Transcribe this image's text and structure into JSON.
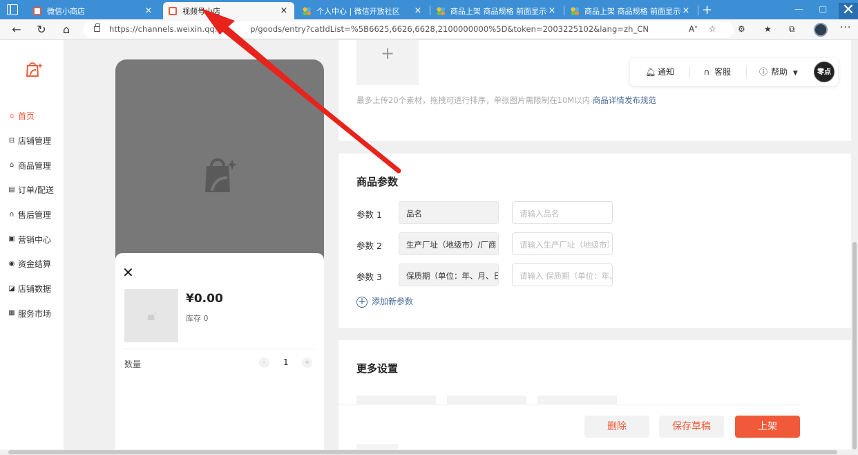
{
  "browser": {
    "tabs": [
      {
        "title": "微信小商店",
        "favicon": "red-bag-icon"
      },
      {
        "title": "视频号小店",
        "favicon": "red-bag-icon"
      },
      {
        "title": "个人中心 | 微信开放社区",
        "favicon": "colorful-dots-icon"
      },
      {
        "title": "商品上架 商品规格 前面显示很乱",
        "favicon": "colorful-dots-icon"
      },
      {
        "title": "商品上架 商品规格 前面显示很乱",
        "favicon": "colorful-dots-icon"
      }
    ],
    "active_tab": 1,
    "url": "https://channels.weixin.qq.com/shop/goods/entry?catIdList=%5B6625,6626,6628,2100000000%5D&token=2003225102&lang=zh_CN",
    "url_shown": "https://channels.weixin.qq.co",
    "url_shown_tail": "p/goods/entry?catIdList=%5B6625,6626,6628,2100000000%5D&token=2003225102&lang=zh_CN",
    "tab_close": "×",
    "new_tab": "+",
    "window_close": "✕"
  },
  "sidebar": {
    "items": [
      {
        "label": "首页",
        "icon": "home-icon",
        "active": true
      },
      {
        "label": "店铺管理",
        "icon": "store-icon"
      },
      {
        "label": "商品管理",
        "icon": "bag-icon"
      },
      {
        "label": "订单/配送",
        "icon": "order-icon"
      },
      {
        "label": "售后管理",
        "icon": "headset-icon"
      },
      {
        "label": "营销中心",
        "icon": "coupon-icon"
      },
      {
        "label": "资金结算",
        "icon": "yuan-icon"
      },
      {
        "label": "店铺数据",
        "icon": "chart-icon"
      },
      {
        "label": "服务市场",
        "icon": "grid-icon"
      }
    ]
  },
  "preview": {
    "price": "¥0.00",
    "stock": "库存 0",
    "qty_label": "数量",
    "qty_value": "1",
    "minus": "-",
    "plus": "+",
    "close": "✕"
  },
  "upload": {
    "plus": "+",
    "tip": "最多上传20个素材，拖拽可进行排序，单张图片需限制在10M以内",
    "link": "商品详情发布规范"
  },
  "toolbar": {
    "notify": "通知",
    "service": "客服",
    "help": "帮助",
    "avatar_text": "零点"
  },
  "params": {
    "title": "商品参数",
    "rows": [
      {
        "label": "参数 1",
        "name": "品名",
        "placeholder": "请输入品名"
      },
      {
        "label": "参数 2",
        "name": "生产厂址（地级市）/厂商",
        "placeholder": "请输入生产厂址（地级市）"
      },
      {
        "label": "参数 3",
        "name": "保质期（单位：年、月、日）",
        "placeholder": "请输入 保质期（单位：年、月、日）"
      }
    ],
    "add": "添加新参数"
  },
  "more": {
    "title": "更多设置"
  },
  "actions": {
    "delete": "删除",
    "save_draft": "保存草稿",
    "publish": "上架"
  },
  "colors": {
    "accent": "#f05a3a",
    "browser_tabbar": "#3c8fd4",
    "link": "#4a6b9a",
    "annotation_arrow": "#e8231c"
  }
}
